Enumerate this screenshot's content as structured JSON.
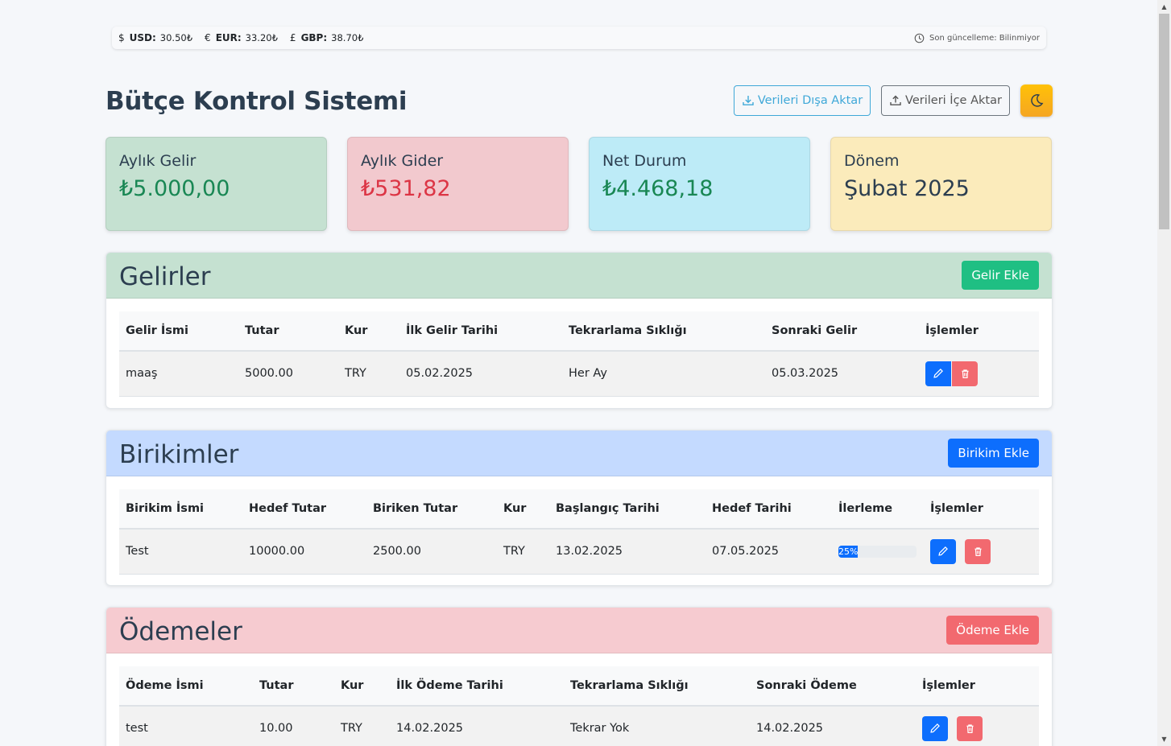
{
  "currency_bar": {
    "rates": [
      {
        "symbol": "$",
        "code": "USD:",
        "value": "30.50₺"
      },
      {
        "symbol": "€",
        "code": "EUR:",
        "value": "33.20₺"
      },
      {
        "symbol": "£",
        "code": "GBP:",
        "value": "38.70₺"
      }
    ],
    "last_update": "Son güncelleme: Bilinmiyor"
  },
  "header": {
    "title": "Bütçe Kontrol Sistemi",
    "export_label": "Verileri Dışa Aktar",
    "import_label": "Verileri İçe Aktar"
  },
  "summary": {
    "income": {
      "label": "Aylık Gelir",
      "value": "₺5.000,00"
    },
    "expense": {
      "label": "Aylık Gider",
      "value": "₺531,82"
    },
    "net": {
      "label": "Net Durum",
      "value": "₺4.468,18"
    },
    "period": {
      "label": "Dönem",
      "value": "Şubat 2025"
    }
  },
  "incomes": {
    "title": "Gelirler",
    "add_label": "Gelir Ekle",
    "columns": [
      "Gelir İsmi",
      "Tutar",
      "Kur",
      "İlk Gelir Tarihi",
      "Tekrarlama Sıklığı",
      "Sonraki Gelir",
      "İşlemler"
    ],
    "rows": [
      {
        "name": "maaş",
        "amount": "5000.00",
        "currency": "TRY",
        "first_date": "05.02.2025",
        "frequency": "Her Ay",
        "next_date": "05.03.2025"
      }
    ]
  },
  "savings": {
    "title": "Birikimler",
    "add_label": "Birikim Ekle",
    "columns": [
      "Birikim İsmi",
      "Hedef Tutar",
      "Biriken Tutar",
      "Kur",
      "Başlangıç Tarihi",
      "Hedef Tarihi",
      "İlerleme",
      "İşlemler"
    ],
    "rows": [
      {
        "name": "Test",
        "target": "10000.00",
        "saved": "2500.00",
        "currency": "TRY",
        "start_date": "13.02.2025",
        "target_date": "07.05.2025",
        "progress_label": "25%",
        "progress": 0.25
      }
    ]
  },
  "payments": {
    "title": "Ödemeler",
    "add_label": "Ödeme Ekle",
    "columns": [
      "Ödeme İsmi",
      "Tutar",
      "Kur",
      "İlk Ödeme Tarihi",
      "Tekrarlama Sıklığı",
      "Sonraki Ödeme",
      "İşlemler"
    ],
    "rows": [
      {
        "name": "test",
        "amount": "10.00",
        "currency": "TRY",
        "first_date": "14.02.2025",
        "frequency": "Tekrar Yok",
        "next_date": "14.02.2025"
      }
    ]
  },
  "colors": {
    "income_bg": "#c5e1d1",
    "expense_bg": "#f2c9ce",
    "net_bg": "#bdebf7",
    "period_bg": "#fbebbb",
    "primary": "#0d6efd",
    "danger": "#f2696f",
    "success": "#198754"
  }
}
